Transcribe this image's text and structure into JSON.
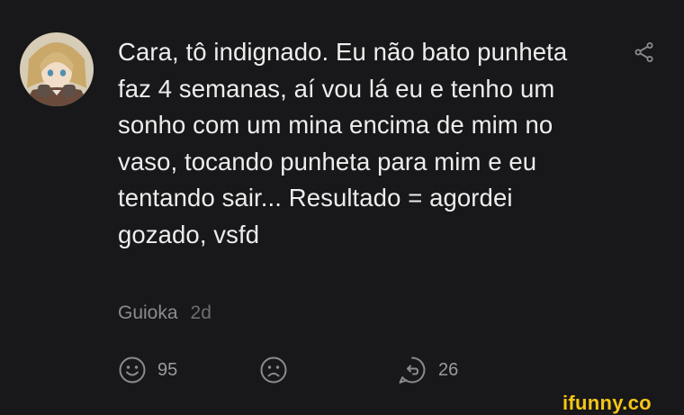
{
  "comment": {
    "text": "Cara, tô indignado. Eu não bato punheta faz 4 semanas, aí vou lá eu e tenho um sonho com um mina encima de mim no vaso, tocando punheta para mim e eu tentando sair... Resultado = agordei gozado, vsfd",
    "author": "Guioka",
    "time": "2d"
  },
  "actions": {
    "smile_count": "95",
    "reply_count": "26"
  },
  "icons": {
    "avatar": "avatar-image",
    "share": "share-icon",
    "smile": "smile-icon",
    "frown": "frown-icon",
    "reply": "reply-icon"
  },
  "watermark": "ifunny.co",
  "colors": {
    "background": "#18181a",
    "text": "#ededed",
    "muted": "#8b8b90",
    "brand": "#f5c518"
  }
}
